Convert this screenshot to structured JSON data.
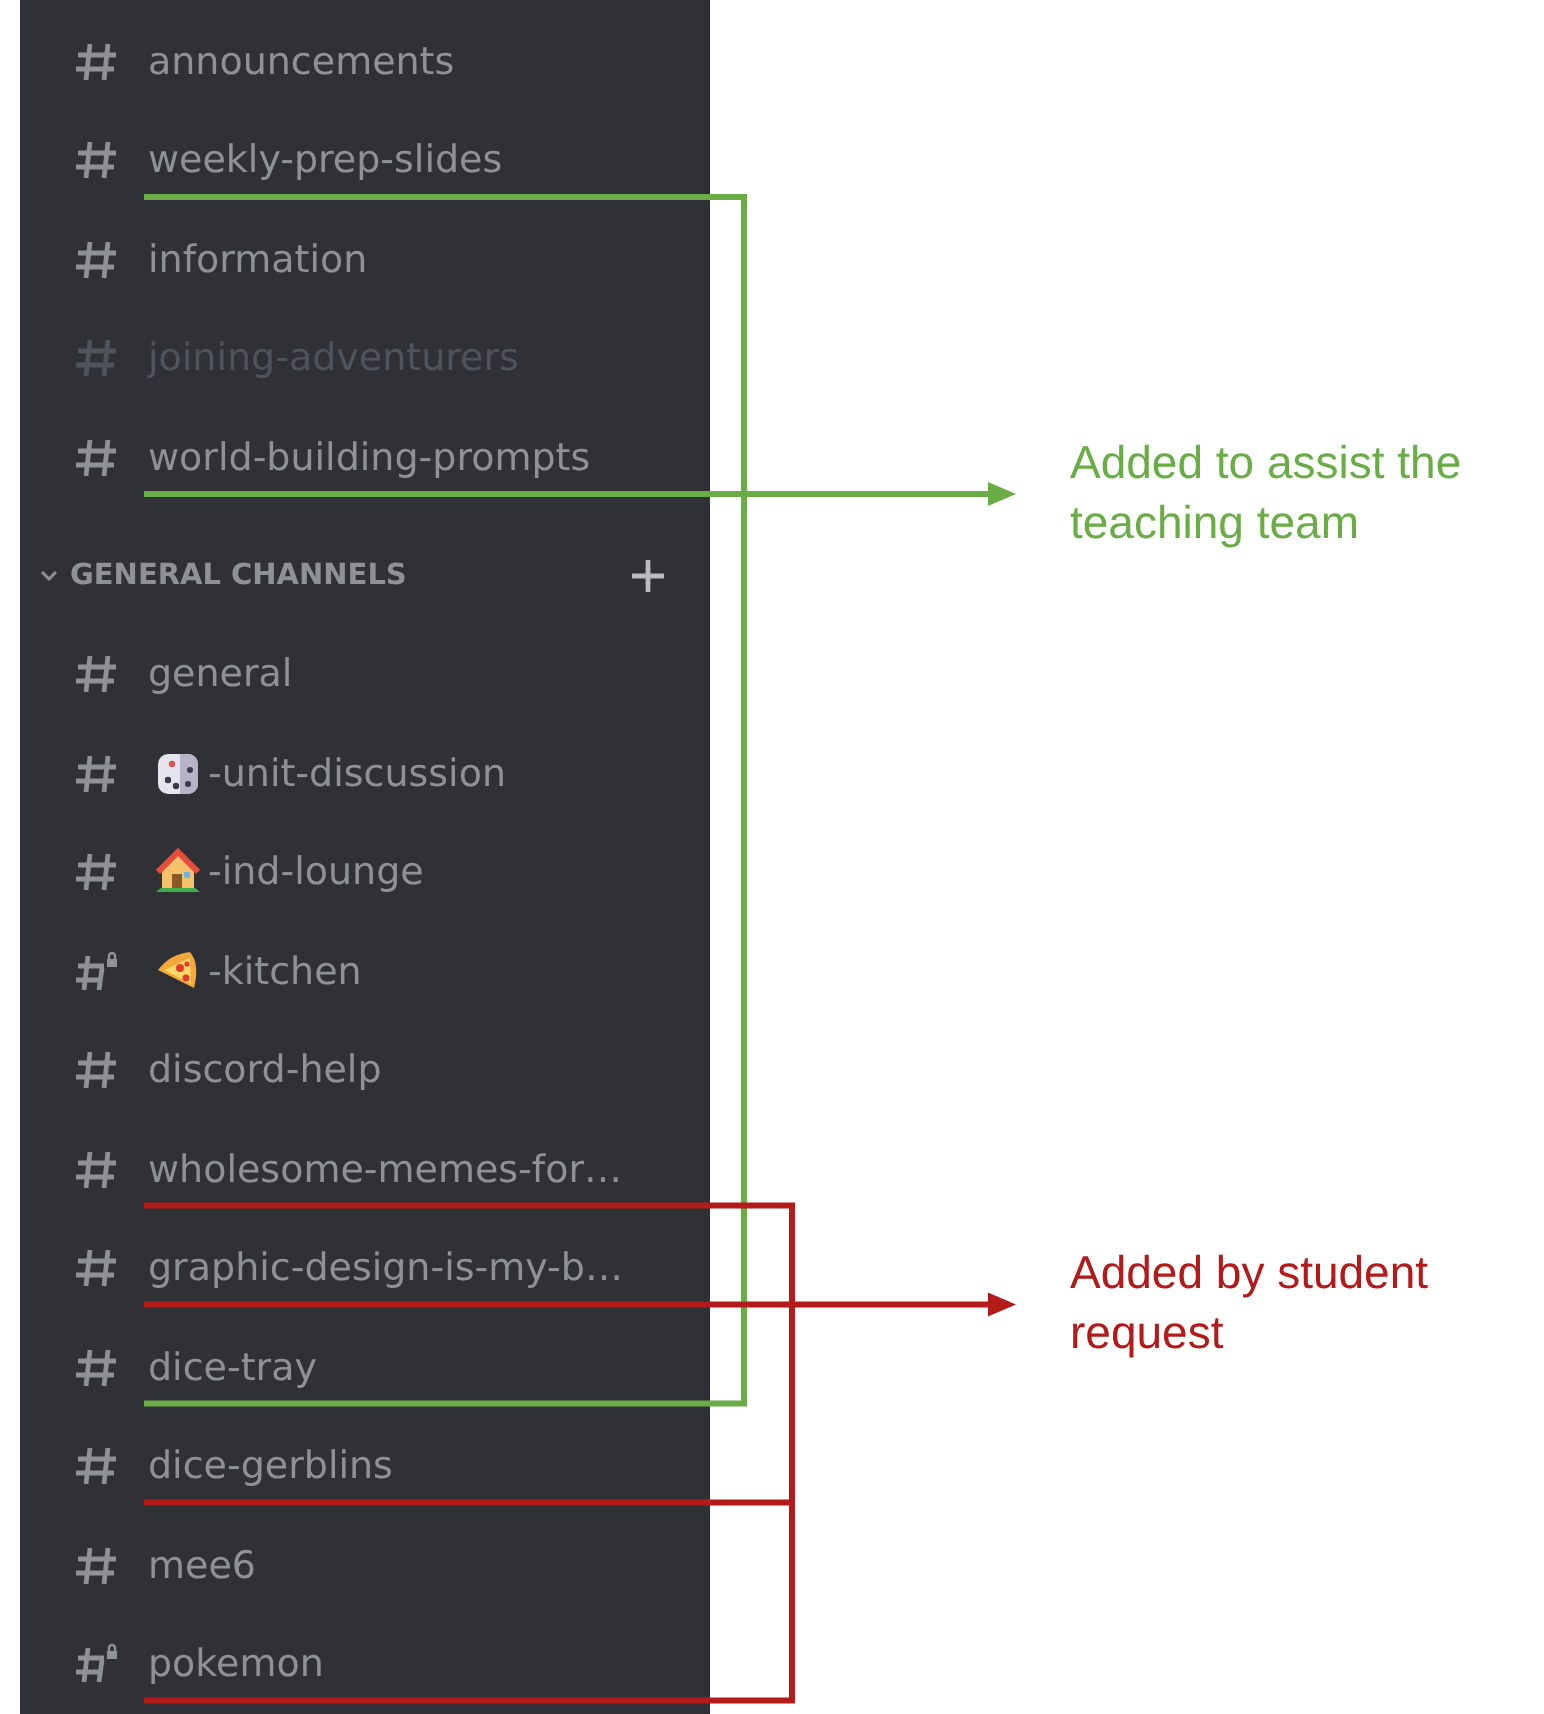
{
  "channels": [
    {
      "name": "announcements",
      "kind": "text",
      "muted": false
    },
    {
      "name": "weekly-prep-slides",
      "kind": "text",
      "muted": false,
      "underline": {
        "kind": "teaching"
      }
    },
    {
      "name": "information",
      "kind": "text",
      "muted": false
    },
    {
      "name": "joining-adventurers",
      "kind": "text",
      "muted": true
    },
    {
      "name": "world-building-prompts",
      "kind": "text",
      "muted": false,
      "underline": {
        "kind": "teaching"
      },
      "arrow": true
    }
  ],
  "category": {
    "title": "GENERAL CHANNELS",
    "channels": [
      {
        "name": "general",
        "kind": "text",
        "muted": false
      },
      {
        "name": "-unit-discussion",
        "kind": "text",
        "muted": false,
        "emoji": {
          "kind": "dice"
        }
      },
      {
        "name": "-ind-lounge",
        "kind": "text",
        "muted": false,
        "emoji": {
          "kind": "house"
        }
      },
      {
        "name": "-kitchen",
        "kind": "locked",
        "muted": false,
        "emoji": {
          "kind": "pizza"
        }
      },
      {
        "name": "discord-help",
        "kind": "text",
        "muted": false
      },
      {
        "name": "wholesome-memes-for…",
        "kind": "text",
        "muted": false,
        "underline": {
          "kind": "student"
        }
      },
      {
        "name": "graphic-design-is-my-b…",
        "kind": "text",
        "muted": false,
        "underline": {
          "kind": "student"
        },
        "arrow": true
      },
      {
        "name": "dice-tray",
        "kind": "text",
        "muted": false,
        "underline": {
          "kind": "teaching"
        }
      },
      {
        "name": "dice-gerblins",
        "kind": "text",
        "muted": false,
        "underline": {
          "kind": "student"
        }
      },
      {
        "name": "mee6",
        "kind": "text",
        "muted": false
      },
      {
        "name": "pokemon",
        "kind": "locked",
        "muted": false,
        "underline": {
          "kind": "student"
        }
      }
    ]
  },
  "annotations": [
    {
      "kind": "teaching",
      "text": "Added to assist the teaching team",
      "color": "#6aac46"
    },
    {
      "kind": "student",
      "text": "Added by student request",
      "color": "#b31b1b"
    }
  ]
}
